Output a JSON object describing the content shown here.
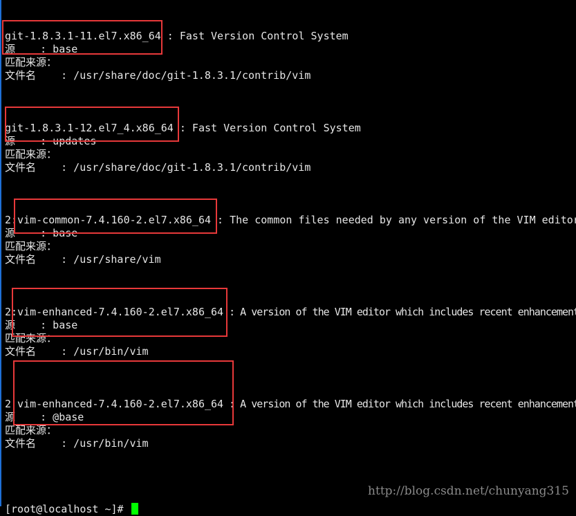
{
  "terminal": {
    "entries": [
      {
        "package": "git-1.8.3.1-11.el7.x86_64",
        "summary": " : Fast Version Control System",
        "repo": "源    : base",
        "match": "匹配来源：",
        "file": "文件名    : /usr/share/doc/git-1.8.3.1/contrib/vim"
      },
      {
        "package": "git-1.8.3.1-12.el7_4.x86_64",
        "summary": " : Fast Version Control System",
        "repo": "源    : updates",
        "match": "匹配来源：",
        "file": "文件名    : /usr/share/doc/git-1.8.3.1/contrib/vim"
      },
      {
        "package": "2:vim-common-7.4.160-2.el7.x86_64",
        "summary": " : The common files needed by any version of the VIM editor",
        "repo": "源    : base",
        "match": "匹配来源：",
        "file": "文件名    : /usr/share/vim"
      },
      {
        "package": "2:vim-enhanced-7.4.160-2.el7.x86_64",
        "summary": " : A version of the VIM editor which includes recent enhancements",
        "repo": "源    : base",
        "match": "匹配来源：",
        "file": "文件名    : /usr/bin/vim"
      },
      {
        "package": "2 vim-enhanced-7.4.160-2.el7.x86_64",
        "summary": " : A version of the VIM editor which includes recent enhancements",
        "repo": "源    : @base",
        "match": "匹配来源：",
        "file": "文件名    : /usr/bin/vim"
      }
    ],
    "prompt": "[root@localhost ~]# "
  },
  "highlight_color": "#e8393a",
  "cursor_color": "#00ff00",
  "watermark": "http://blog.csdn.net/chunyang315"
}
